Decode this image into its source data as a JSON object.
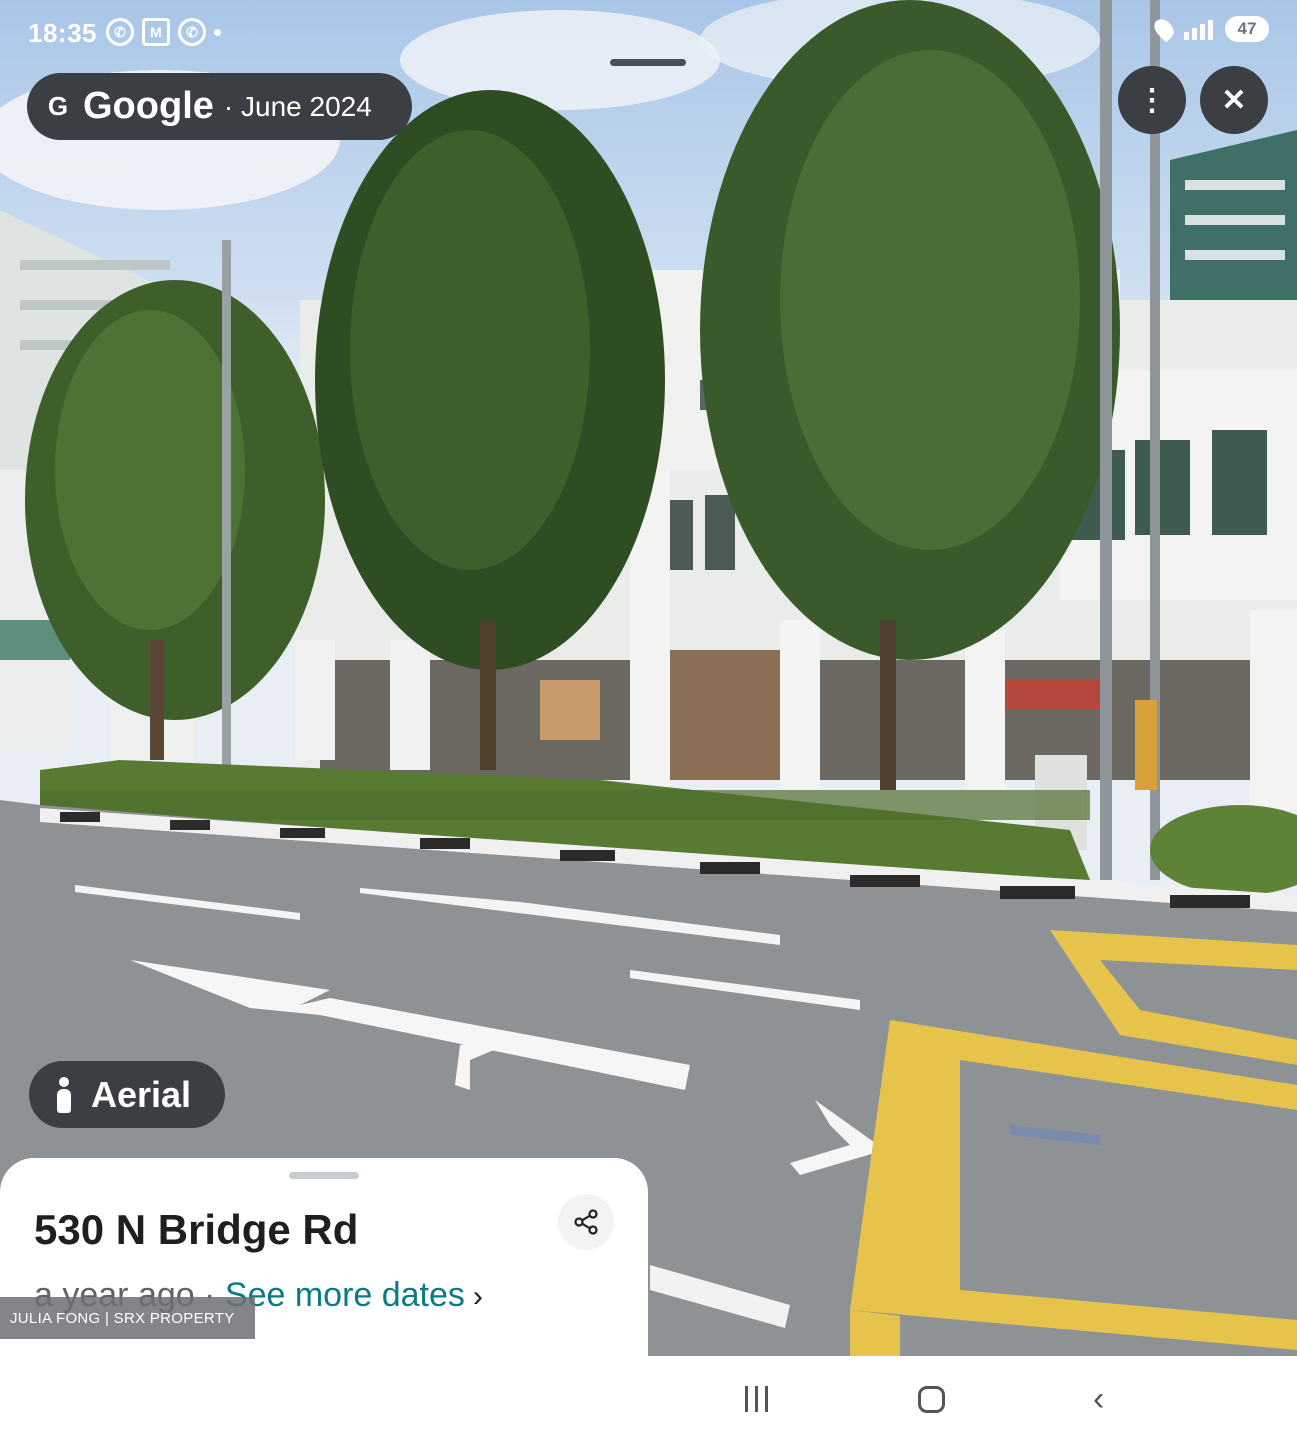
{
  "status_bar": {
    "time": "18:35",
    "app_icons": [
      "whatsapp-icon",
      "gmail-icon",
      "whatsapp-icon"
    ],
    "battery": "47"
  },
  "street_view": {
    "provider": "Google",
    "capture_date": "· June 2024",
    "more_icon": "more-vertical-icon",
    "close_icon": "close-icon"
  },
  "aerial_button": {
    "label": "Aerial",
    "icon": "person-icon"
  },
  "info_sheet": {
    "address": "530 N Bridge Rd",
    "relative_date": "a year ago · ",
    "see_more_dates": "See more dates",
    "chevron": "›",
    "share_icon": "share-icon"
  },
  "watermark": "JULIA FONG | SRX PROPERTY",
  "navigation_bar": {
    "recent_icon": "recent-apps-icon",
    "home_icon": "home-icon",
    "back_icon": "back-icon"
  },
  "colors": {
    "chip_bg": "#3b3e43",
    "link": "#0b7b83",
    "road": "#8e9194",
    "road_marking_yellow": "#e8c44a",
    "foliage": "#3f5f2a"
  }
}
